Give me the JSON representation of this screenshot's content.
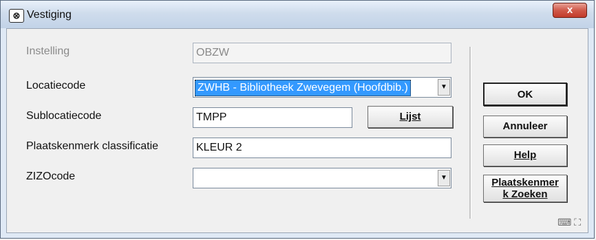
{
  "window": {
    "title": "Vestiging",
    "icon": "app-icon",
    "close_label": "x"
  },
  "form": {
    "instelling": {
      "label": "Instelling",
      "value": "OBZW"
    },
    "locatiecode": {
      "label": "Locatiecode",
      "value": "ZWHB - Bibliotheek Zwevegem (Hoofdbib.)"
    },
    "sublocatiecode": {
      "label": "Sublocatiecode",
      "value": "TMPP"
    },
    "plaatskenmerk": {
      "label": "Plaatskenmerk classificatie",
      "value": "KLEUR 2"
    },
    "zizocode": {
      "label": "ZIZOcode",
      "value": ""
    }
  },
  "buttons": {
    "lijst": "Lijst",
    "ok": "OK",
    "annuleer": "Annuleer",
    "help": "Help",
    "zoeken_line1": "Plaatskenmer",
    "zoeken_line2": "k Zoeken"
  },
  "colors": {
    "selection": "#3399ff",
    "close": "#c23a2a"
  }
}
